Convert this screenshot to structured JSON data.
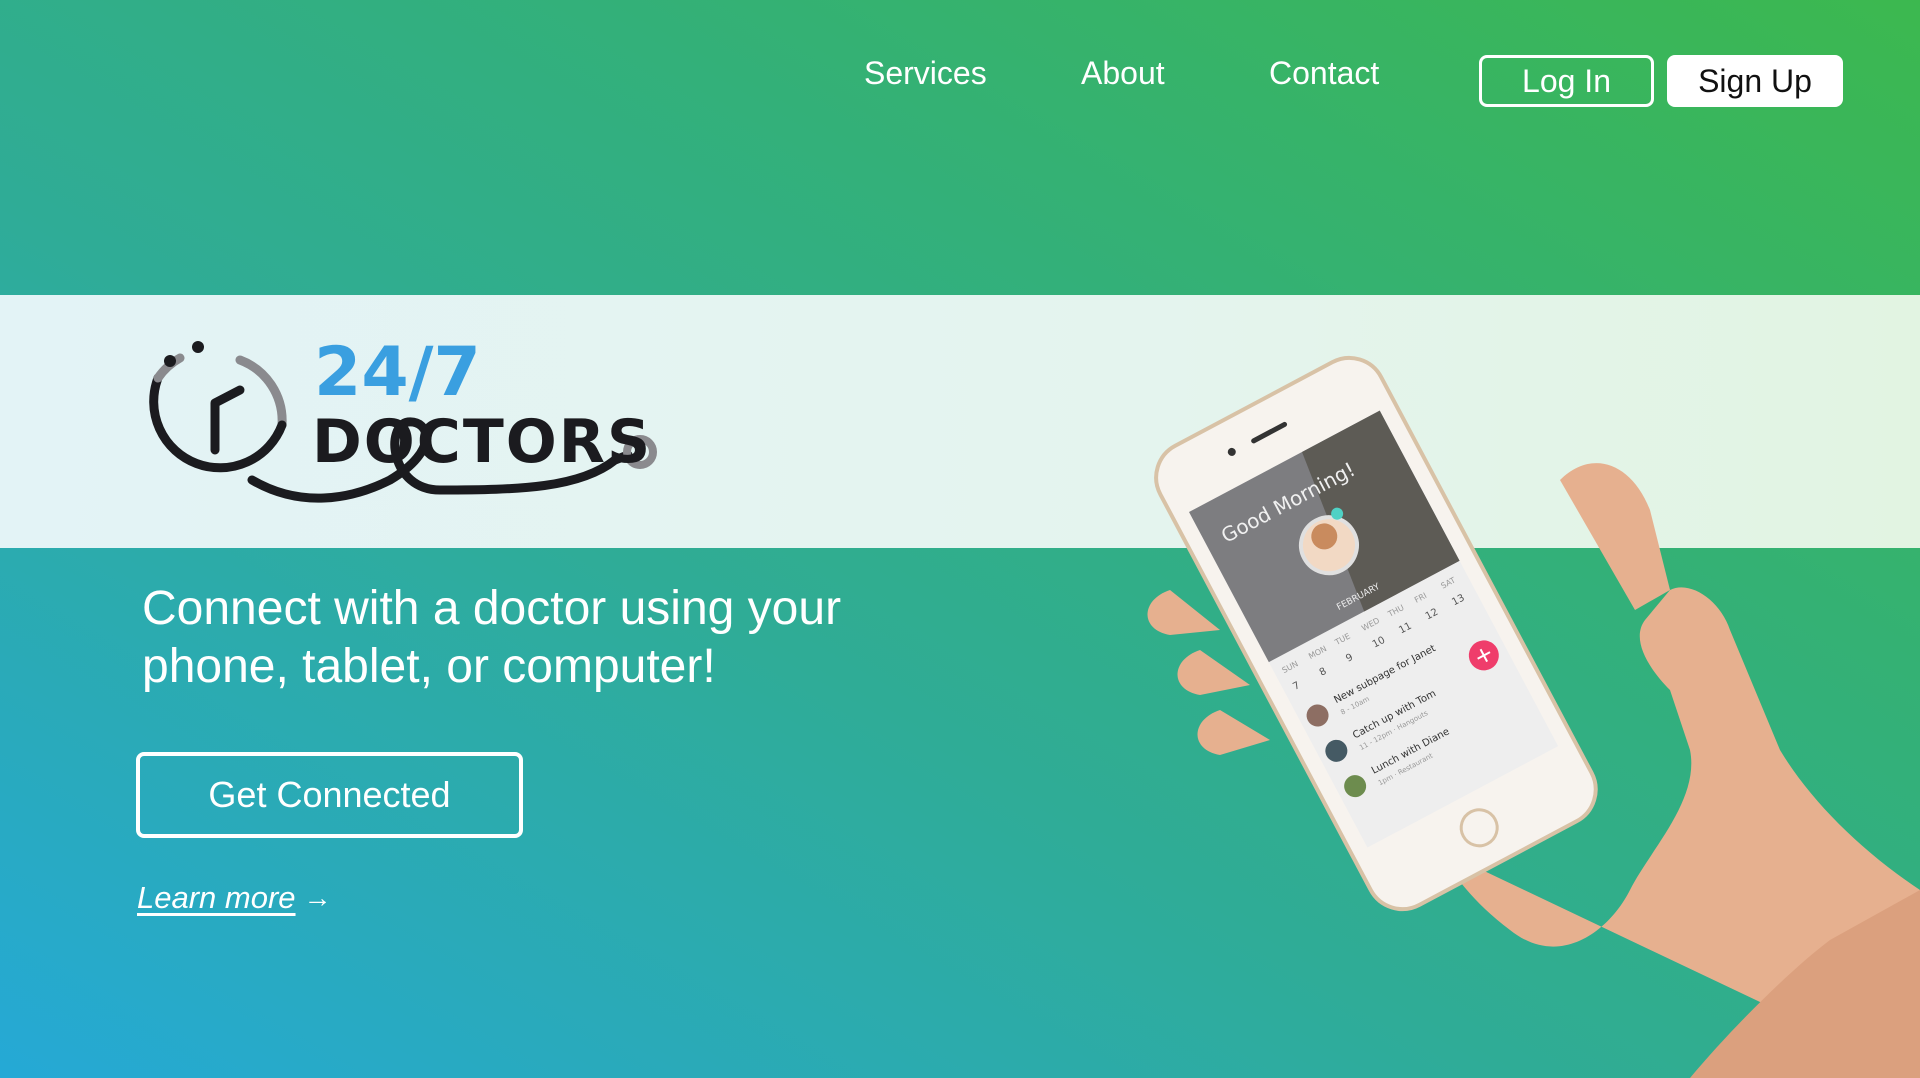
{
  "nav": {
    "links": [
      "Services",
      "About",
      "Contact"
    ],
    "login_label": "Log In",
    "signup_label": "Sign Up"
  },
  "logo": {
    "line1": "24/7",
    "line2": "DOCTORS"
  },
  "hero": {
    "line1": "Connect with a doctor using your",
    "line2": "phone, tablet, or computer!",
    "cta_label": "Get Connected",
    "learn_more_label": "Learn more",
    "learn_more_arrow": "→"
  },
  "phone": {
    "greeting": "Good Morning!",
    "month": "FEBRUARY",
    "weekdays": [
      "SUN",
      "MON",
      "TUE",
      "WED",
      "THU",
      "FRI",
      "SAT"
    ],
    "dates": [
      "7",
      "8",
      "9",
      "10",
      "11",
      "12",
      "13"
    ],
    "events": [
      {
        "title": "New subpage for Janet",
        "sub": "8 - 10am"
      },
      {
        "title": "Catch up with Tom",
        "sub": "11 - 12pm · Hangouts"
      },
      {
        "title": "Lunch with Diane",
        "sub": "1pm · Restaurant"
      }
    ]
  },
  "colors": {
    "accent_blue": "#3a9fe0",
    "logo_black": "#1b1b1f",
    "fab_red": "#ef3d6b",
    "gradient_green": "#3cb84f",
    "gradient_blue": "#25a9d6"
  }
}
